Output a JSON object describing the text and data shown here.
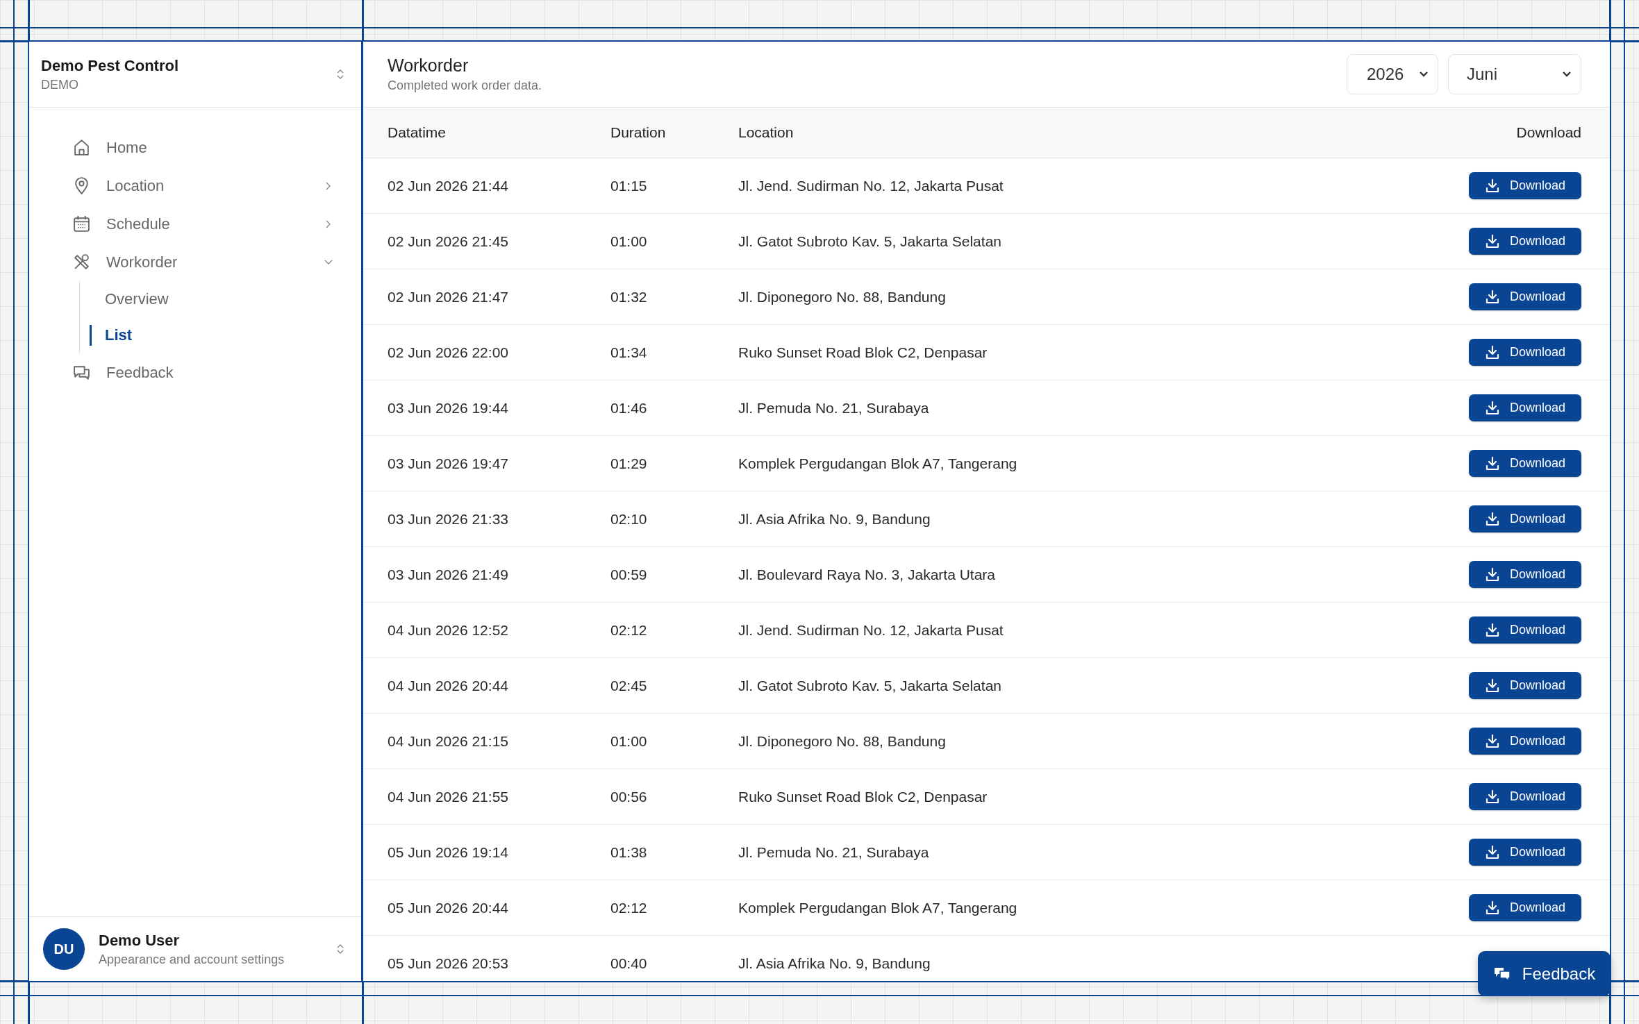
{
  "sidebar": {
    "org": {
      "name": "Demo Pest Control",
      "code": "DEMO"
    },
    "nav": [
      {
        "label": "Home",
        "kind": "link"
      },
      {
        "label": "Location",
        "kind": "group",
        "expanded": false
      },
      {
        "label": "Schedule",
        "kind": "group",
        "expanded": false
      },
      {
        "label": "Workorder",
        "kind": "group",
        "expanded": true,
        "children": [
          {
            "label": "Overview",
            "selected": false
          },
          {
            "label": "List",
            "selected": true
          }
        ]
      },
      {
        "label": "Feedback",
        "kind": "link"
      }
    ],
    "user": {
      "initials": "DU",
      "name": "Demo User",
      "subtitle": "Appearance and account settings"
    }
  },
  "header": {
    "title": "Workorder",
    "subtitle": "Completed work order data.",
    "filters": [
      {
        "value": "2026"
      },
      {
        "value": "Juni"
      }
    ]
  },
  "table": {
    "columns": [
      "Datatime",
      "Duration",
      "Location",
      "Download"
    ],
    "rows": [
      {
        "datatime": "02 Jun 2026 21:44",
        "duration": "01:15",
        "location": "Jl. Jend. Sudirman No. 12, Jakarta Pusat",
        "action": "Download"
      },
      {
        "datatime": "02 Jun 2026 21:45",
        "duration": "01:00",
        "location": "Jl. Gatot Subroto Kav. 5, Jakarta Selatan",
        "action": "Download"
      },
      {
        "datatime": "02 Jun 2026 21:47",
        "duration": "01:32",
        "location": "Jl. Diponegoro No. 88, Bandung",
        "action": "Download"
      },
      {
        "datatime": "02 Jun 2026 22:00",
        "duration": "01:34",
        "location": "Ruko Sunset Road Blok C2, Denpasar",
        "action": "Download"
      },
      {
        "datatime": "03 Jun 2026 19:44",
        "duration": "01:46",
        "location": "Jl. Pemuda No. 21, Surabaya",
        "action": "Download"
      },
      {
        "datatime": "03 Jun 2026 19:47",
        "duration": "01:29",
        "location": "Komplek Pergudangan Blok A7, Tangerang",
        "action": "Download"
      },
      {
        "datatime": "03 Jun 2026 21:33",
        "duration": "02:10",
        "location": "Jl. Asia Afrika No. 9, Bandung",
        "action": "Download"
      },
      {
        "datatime": "03 Jun 2026 21:49",
        "duration": "00:59",
        "location": "Jl. Boulevard Raya No. 3, Jakarta Utara",
        "action": "Download"
      },
      {
        "datatime": "04 Jun 2026 12:52",
        "duration": "02:12",
        "location": "Jl. Jend. Sudirman No. 12, Jakarta Pusat",
        "action": "Download"
      },
      {
        "datatime": "04 Jun 2026 20:44",
        "duration": "02:45",
        "location": "Jl. Gatot Subroto Kav. 5, Jakarta Selatan",
        "action": "Download"
      },
      {
        "datatime": "04 Jun 2026 21:15",
        "duration": "01:00",
        "location": "Jl. Diponegoro No. 88, Bandung",
        "action": "Download"
      },
      {
        "datatime": "04 Jun 2026 21:55",
        "duration": "00:56",
        "location": "Ruko Sunset Road Blok C2, Denpasar",
        "action": "Download"
      },
      {
        "datatime": "05 Jun 2026 19:14",
        "duration": "01:38",
        "location": "Jl. Pemuda No. 21, Surabaya",
        "action": "Download"
      },
      {
        "datatime": "05 Jun 2026 20:44",
        "duration": "02:12",
        "location": "Komplek Pergudangan Blok A7, Tangerang",
        "action": "Download"
      },
      {
        "datatime": "05 Jun 2026 20:53",
        "duration": "00:40",
        "location": "Jl. Asia Afrika No. 9, Bandung"
      }
    ]
  },
  "feedback_button": {
    "label": "Feedback"
  }
}
